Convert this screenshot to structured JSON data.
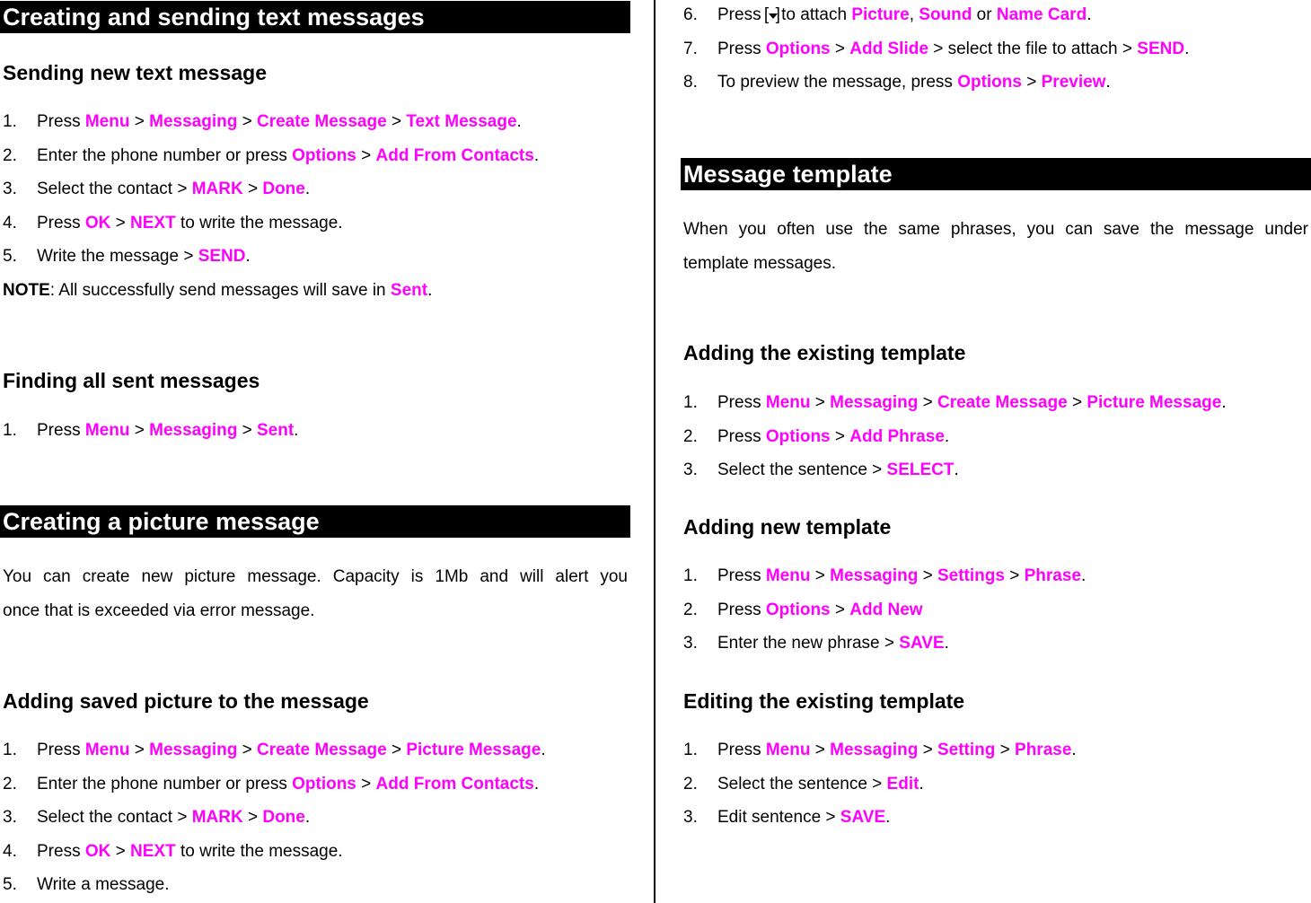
{
  "colors": {
    "highlight": "#ff00ff",
    "heading_bar_bg": "#000000",
    "heading_bar_text": "#ffffff"
  },
  "left": {
    "section1": {
      "title": "Creating and sending text messages",
      "sub1": {
        "title": "Sending new text message",
        "steps": [
          {
            "num": "1.",
            "parts": [
              {
                "t": "Press "
              },
              {
                "t": "Menu",
                "h": true
              },
              {
                "t": " > "
              },
              {
                "t": "Messaging",
                "h": true
              },
              {
                "t": " > "
              },
              {
                "t": "Create Message",
                "h": true
              },
              {
                "t": " > "
              },
              {
                "t": "Text Message",
                "h": true
              },
              {
                "t": "."
              }
            ]
          },
          {
            "num": "2.",
            "parts": [
              {
                "t": "Enter the phone number or press "
              },
              {
                "t": "Options",
                "h": true
              },
              {
                "t": " > "
              },
              {
                "t": "Add From Contacts",
                "h": true
              },
              {
                "t": "."
              }
            ]
          },
          {
            "num": "3.",
            "parts": [
              {
                "t": "Select the contact > "
              },
              {
                "t": "MARK",
                "h": true
              },
              {
                "t": " > "
              },
              {
                "t": "Done",
                "h": true
              },
              {
                "t": "."
              }
            ]
          },
          {
            "num": "4.",
            "parts": [
              {
                "t": "Press "
              },
              {
                "t": "OK",
                "h": true
              },
              {
                "t": " > "
              },
              {
                "t": "NEXT",
                "h": true
              },
              {
                "t": " to write the message."
              }
            ]
          },
          {
            "num": "5.",
            "parts": [
              {
                "t": "Write the message > "
              },
              {
                "t": "SEND",
                "h": true
              },
              {
                "t": "."
              }
            ]
          }
        ],
        "note": {
          "label": "NOTE",
          "text": ": All successfully send messages will save in ",
          "link": "Sent",
          "end": "."
        }
      },
      "sub2": {
        "title": "Finding all sent messages",
        "steps": [
          {
            "num": "1.",
            "parts": [
              {
                "t": "Press "
              },
              {
                "t": "Menu",
                "h": true
              },
              {
                "t": " > "
              },
              {
                "t": "Messaging",
                "h": true
              },
              {
                "t": " > "
              },
              {
                "t": "Sent",
                "h": true
              },
              {
                "t": "."
              }
            ]
          }
        ]
      }
    },
    "section2": {
      "title": "Creating a picture message",
      "intro_line1": "You can create new picture message. Capacity is 1Mb and will alert you",
      "intro_line2": "once that is exceeded via error message.",
      "sub1": {
        "title": "Adding saved picture to the message",
        "steps": [
          {
            "num": "1.",
            "parts": [
              {
                "t": "Press "
              },
              {
                "t": "Menu",
                "h": true
              },
              {
                "t": " > "
              },
              {
                "t": "Messaging",
                "h": true
              },
              {
                "t": " > "
              },
              {
                "t": "Create Message",
                "h": true
              },
              {
                "t": " > "
              },
              {
                "t": "Picture Message",
                "h": true
              },
              {
                "t": "."
              }
            ]
          },
          {
            "num": "2.",
            "parts": [
              {
                "t": "Enter the phone number or press "
              },
              {
                "t": "Options",
                "h": true
              },
              {
                "t": " > "
              },
              {
                "t": "Add From Contacts",
                "h": true
              },
              {
                "t": "."
              }
            ]
          },
          {
            "num": "3.",
            "parts": [
              {
                "t": "Select the contact > "
              },
              {
                "t": "MARK",
                "h": true
              },
              {
                "t": " > "
              },
              {
                "t": "Done",
                "h": true
              },
              {
                "t": "."
              }
            ]
          },
          {
            "num": "4.",
            "parts": [
              {
                "t": "Press "
              },
              {
                "t": "OK",
                "h": true
              },
              {
                "t": " > "
              },
              {
                "t": "NEXT",
                "h": true
              },
              {
                "t": " to write the message."
              }
            ]
          },
          {
            "num": "5.",
            "parts": [
              {
                "t": "Write a message."
              }
            ]
          }
        ]
      }
    }
  },
  "right": {
    "continued_steps": [
      {
        "num": "6.",
        "parts": [
          {
            "t": "Press "
          },
          {
            "icon": "down-key-icon"
          },
          {
            "t": " to attach "
          },
          {
            "t": "Picture",
            "h": true
          },
          {
            "t": ", "
          },
          {
            "t": "Sound",
            "h": true
          },
          {
            "t": " or "
          },
          {
            "t": "Name Card",
            "h": true
          },
          {
            "t": "."
          }
        ]
      },
      {
        "num": "7.",
        "parts": [
          {
            "t": "Press "
          },
          {
            "t": "Options",
            "h": true
          },
          {
            "t": " > "
          },
          {
            "t": "Add Slide",
            "h": true
          },
          {
            "t": " > select the file to attach > "
          },
          {
            "t": "SEND",
            "h": true
          },
          {
            "t": "."
          }
        ]
      },
      {
        "num": "8.",
        "parts": [
          {
            "t": "To preview the message, press "
          },
          {
            "t": "Options",
            "h": true
          },
          {
            "t": " > "
          },
          {
            "t": "Preview",
            "h": true
          },
          {
            "t": "."
          }
        ]
      }
    ],
    "section3": {
      "title": "Message template",
      "intro_line1": "When you often use the same phrases, you can save the message under",
      "intro_line2": "template messages.",
      "sub1": {
        "title": "Adding the existing template",
        "steps": [
          {
            "num": "1.",
            "parts": [
              {
                "t": "Press "
              },
              {
                "t": "Menu",
                "h": true
              },
              {
                "t": " > "
              },
              {
                "t": "Messaging",
                "h": true
              },
              {
                "t": " > "
              },
              {
                "t": "Create Message",
                "h": true
              },
              {
                "t": " > "
              },
              {
                "t": "Picture Message",
                "h": true
              },
              {
                "t": "."
              }
            ]
          },
          {
            "num": "2.",
            "parts": [
              {
                "t": "Press "
              },
              {
                "t": "Options",
                "h": true
              },
              {
                "t": " > "
              },
              {
                "t": "Add Phrase",
                "h": true
              },
              {
                "t": "."
              }
            ]
          },
          {
            "num": "3.",
            "parts": [
              {
                "t": "Select the sentence > "
              },
              {
                "t": "SELECT",
                "h": true
              },
              {
                "t": "."
              }
            ]
          }
        ]
      },
      "sub2": {
        "title": "Adding new template",
        "steps": [
          {
            "num": "1.",
            "parts": [
              {
                "t": "Press "
              },
              {
                "t": "Menu",
                "h": true
              },
              {
                "t": " > "
              },
              {
                "t": "Messaging",
                "h": true
              },
              {
                "t": " > "
              },
              {
                "t": "Settings",
                "h": true
              },
              {
                "t": " > "
              },
              {
                "t": "Phrase",
                "h": true
              },
              {
                "t": "."
              }
            ]
          },
          {
            "num": "2.",
            "parts": [
              {
                "t": "Press "
              },
              {
                "t": "Options",
                "h": true
              },
              {
                "t": " > "
              },
              {
                "t": "Add New",
                "h": true
              }
            ]
          },
          {
            "num": "3.",
            "parts": [
              {
                "t": "Enter the new phrase > "
              },
              {
                "t": "SAVE",
                "h": true
              },
              {
                "t": "."
              }
            ]
          }
        ]
      },
      "sub3": {
        "title": "Editing the existing template",
        "steps": [
          {
            "num": "1.",
            "parts": [
              {
                "t": "Press "
              },
              {
                "t": "Menu",
                "h": true
              },
              {
                "t": " > "
              },
              {
                "t": "Messaging",
                "h": true
              },
              {
                "t": " > "
              },
              {
                "t": "Setting",
                "h": true
              },
              {
                "t": " > "
              },
              {
                "t": "Phrase",
                "h": true
              },
              {
                "t": "."
              }
            ]
          },
          {
            "num": "2.",
            "parts": [
              {
                "t": "Select the sentence > "
              },
              {
                "t": "Edit",
                "h": true
              },
              {
                "t": "."
              }
            ]
          },
          {
            "num": "3.",
            "parts": [
              {
                "t": "Edit sentence > "
              },
              {
                "t": "SAVE",
                "h": true
              },
              {
                "t": "."
              }
            ]
          }
        ]
      }
    }
  }
}
